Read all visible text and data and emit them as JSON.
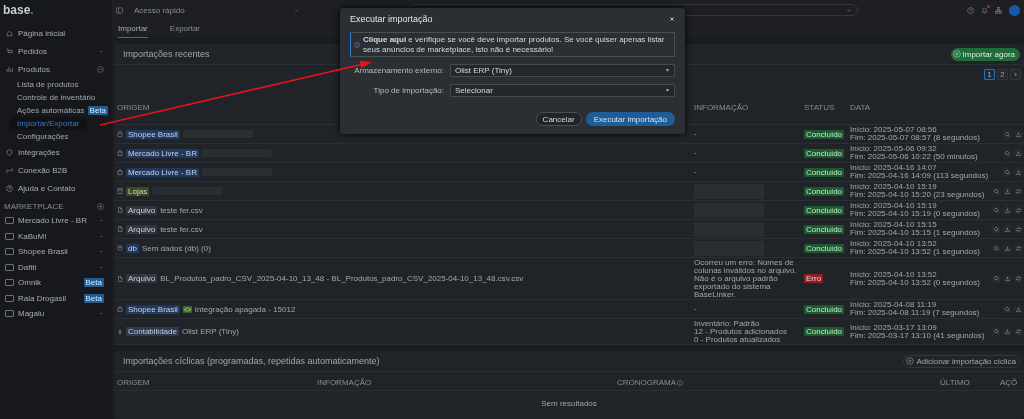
{
  "sidebar": {
    "logo": "base.",
    "nav": [
      {
        "label": "Página inicial",
        "kind": "link"
      },
      {
        "label": "Pedidos",
        "kind": "group",
        "expanded": false
      },
      {
        "label": "Produtos",
        "kind": "group",
        "expanded": true,
        "children": [
          {
            "label": "Lista de produtos",
            "selected": false
          },
          {
            "label": "Controle de inventário",
            "selected": false
          },
          {
            "label": "Ações automáticas",
            "badge": "Beta",
            "selected": false
          },
          {
            "label": "Importar/Exportar",
            "selected": true
          },
          {
            "label": "Configurações",
            "selected": false
          }
        ]
      },
      {
        "label": "Integrações",
        "kind": "link"
      },
      {
        "label": "Conexão B2B",
        "kind": "link"
      },
      {
        "label": "Ajuda e Contato",
        "kind": "link"
      }
    ],
    "marketplace_heading": "MARKETPLACE",
    "marketplaces": [
      {
        "label": "Mercado Livre - BR",
        "kind": "menu"
      },
      {
        "label": "KaBuM!",
        "kind": "menu"
      },
      {
        "label": "Shopee Brasil",
        "kind": "menu"
      },
      {
        "label": "Dafiti",
        "kind": "menu"
      },
      {
        "label": "Omnik",
        "kind": "badge",
        "badge": "Beta"
      },
      {
        "label": "Raia Drogasil",
        "kind": "badge",
        "badge": "Beta"
      },
      {
        "label": "Magalu",
        "kind": "menu"
      }
    ]
  },
  "topbar": {
    "quick_access": "Acesso rápido"
  },
  "tabs": [
    {
      "label": "Importar",
      "selected": true
    },
    {
      "label": "Exportar",
      "selected": false
    }
  ],
  "recent": {
    "title": "Importações recentes",
    "action": "Importar agora",
    "pages": [
      {
        "label": "1",
        "selected": true
      },
      {
        "label": "2",
        "selected": false
      },
      {
        "label": "›",
        "selected": false
      }
    ],
    "columns": [
      "ORIGEM",
      "INFORMAÇÃO",
      "STATUS",
      "DATA"
    ],
    "rows": [
      {
        "kind": "marketplace",
        "tag": {
          "label": "Shopee Brasil",
          "color": "#1f3a5c"
        },
        "name_hidden": true,
        "info": "-",
        "status": "Concluído",
        "failed": false,
        "start": "Início: 2025-05-07 08:56",
        "end": "Fim: 2025-05-07 08:57 (8 segundos)",
        "retry": false
      },
      {
        "kind": "marketplace",
        "tag": {
          "label": "Mercado Livre - BR",
          "color": "#1f3a5c"
        },
        "name_hidden": true,
        "info": "-",
        "status": "Concluído",
        "failed": false,
        "start": "Início: 2025-05-06 09:32",
        "end": "Fim: 2025-05-06 10:22 (50 minutos)",
        "retry": false
      },
      {
        "kind": "marketplace",
        "tag": {
          "label": "Mercado Livre - BR",
          "color": "#1f3a5c"
        },
        "name_hidden": true,
        "info": "-",
        "status": "Concluído",
        "failed": false,
        "start": "Início: 2025-04-16 14:07",
        "end": "Fim: 2025-04-16 14:09 (113 segundos)",
        "retry": false
      },
      {
        "kind": "store",
        "tag": {
          "label": "Lojas",
          "color": "#3b4a1c"
        },
        "name_hidden": true,
        "info_hidden": true,
        "status": "Concluído",
        "failed": false,
        "start": "Início: 2025-04-10 15:19",
        "end": "Fim: 2025-04-10 15:20 (23 segundos)",
        "retry": true
      },
      {
        "kind": "file",
        "tag": {
          "label": "Arquivo",
          "color": "#33363c"
        },
        "name": "teste fer.csv",
        "info_hidden": true,
        "status": "Concluído",
        "failed": false,
        "start": "Início: 2025-04-10 15:19",
        "end": "Fim: 2025-04-10 15:19 (0 segundos)",
        "retry": true
      },
      {
        "kind": "file",
        "tag": {
          "label": "Arquivo",
          "color": "#33363c"
        },
        "name": "teste fer.csv",
        "info_hidden": true,
        "status": "Concluído",
        "failed": false,
        "start": "Início: 2025-04-10 15:15",
        "end": "Fim: 2025-04-10 15:15 (1 segundos)",
        "retry": true
      },
      {
        "kind": "database",
        "tag": {
          "label": "db",
          "color": "#1f3a5c"
        },
        "name": "Sem dados (db) (0)",
        "info_hidden": true,
        "status": "Concluído",
        "failed": false,
        "start": "Início: 2025-04-10 13:52",
        "end": "Fim: 2025-04-10 13:52 (1 segundos)",
        "retry": true
      },
      {
        "kind": "file",
        "tag": {
          "label": "Arquivo",
          "color": "#33363c"
        },
        "name": "BL_Produtos_padro_CSV_2025-04-10_13_48 - BL_Produtos_padro_CSV_2025-04-10_13_48.csv.csv",
        "info": "Ocorreu um erro: Nomes de colunas inválidos no arquivo. Não é o arquivo padrão exportado do sistema BaseLinker.",
        "status": "Erro",
        "failed": true,
        "start": "Início: 2025-04-10 13:52",
        "end": "Fim: 2025-04-10 13:52 (0 segundos)",
        "retry": true
      },
      {
        "kind": "marketplace",
        "tag": {
          "label": "Shopee Brasil",
          "color": "#1f3a5c"
        },
        "flag": true,
        "name": "Integração apagada - 15012",
        "info": "-",
        "status": "Concluído",
        "failed": false,
        "start": "Início: 2025-04-08 11:19",
        "end": "Fim: 2025-04-08 11:19 (7 segundos)",
        "retry": false
      },
      {
        "kind": "erp",
        "tag": {
          "label": "Contabilidade",
          "color": "#2c3a4d"
        },
        "name": "Olist ERP (Tiny)",
        "info": "Inventário: Padrão\n12 - Produtos adicionados\n0 - Produtos atualizados",
        "status": "Concluído",
        "failed": false,
        "start": "Início: 2025-03-17 13:09",
        "end": "Fim: 2025-03-17 13:10 (41 segundos)",
        "retry": true
      }
    ]
  },
  "cyclic": {
    "title": "Importações cíclicas (programadas, repetidas automaticamente)",
    "action": "Adicionar importação cíclica",
    "columns": [
      "ORIGEM",
      "INFORMAÇÃO",
      "CRONOGRAMA",
      "ÚLTIMO",
      "AÇÕ"
    ],
    "empty": "Sem resultados"
  },
  "modal": {
    "title": "Executar importação",
    "notice": "**Clique aqui** e verifique se você deve importar produtos. Se você quiser apenas listar seus anúncios de marketplace, isto não é necessário!",
    "fields": [
      {
        "label": "Armazenamento externo:",
        "value": "Olist ERP (Tiny)"
      },
      {
        "label": "Tipo de importação:",
        "value": "Selecionar"
      }
    ],
    "buttons": [
      {
        "label": "Cancelar",
        "kind": "secondary"
      },
      {
        "label": "Executar importação",
        "kind": "primary"
      }
    ]
  }
}
